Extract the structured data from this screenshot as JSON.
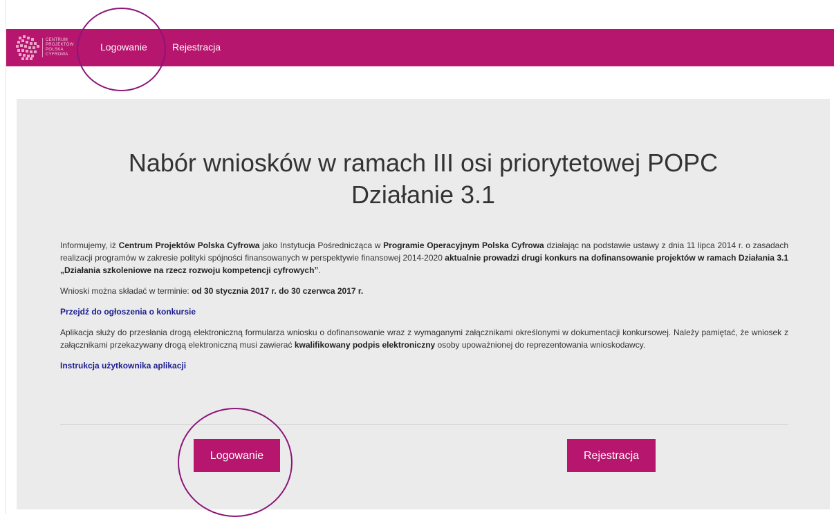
{
  "colors": {
    "brand": "#b6166d",
    "link": "#1b1d8f",
    "panel": "#ebebeb",
    "annotation": "#8b1578"
  },
  "header": {
    "logo_lines": [
      "CENTRUM",
      "PROJEKTÓW",
      "POLSKA",
      "CYFROWA"
    ],
    "logo_icon": "cppc-logo-icon",
    "nav": {
      "login": "Logowanie",
      "register": "Rejestracja"
    }
  },
  "main": {
    "title_line1": "Nabór wniosków w ramach III osi priorytetowej POPC",
    "title_line2": "Działanie 3.1",
    "p1": {
      "t1": "Informujemy, iż ",
      "b1": "Centrum Projektów Polska Cyfrowa",
      "t2": " jako Instytucja Pośrednicząca w ",
      "b2": "Programie Operacyjnym Polska Cyfrowa",
      "t3": " działając na podstawie ustawy z dnia 11 lipca 2014 r. o zasadach realizacji programów w zakresie polityki spójności finansowanych w perspektywie finansowej 2014-2020 ",
      "b3": "aktualnie prowadzi drugi konkurs na dofinansowanie projektów w ramach Działania 3.1 „Działania szkoleniowe na rzecz rozwoju kompetencji cyfrowych”",
      "t4": "."
    },
    "p2": {
      "t1": "Wnioski można składać w terminie: ",
      "b1": "od 30 stycznia 2017 r. do 30 czerwca 2017 r."
    },
    "link_announcement": "Przejdź do ogłoszenia o konkursie",
    "p3": {
      "t1": "Aplikacja służy do przesłania drogą elektroniczną formularza wniosku o dofinansowanie wraz z wymaganymi załącznikami określonymi w dokumentacji konkursowej. Należy pamiętać, że wniosek z załącznikami przekazywany drogą elektroniczną musi zawierać ",
      "b1": "kwalifikowany podpis elektroniczny",
      "t2": " osoby upoważnionej do reprezentowania wnioskodawcy."
    },
    "link_manual": "Instrukcja użytkownika aplikacji",
    "buttons": {
      "login": "Logowanie",
      "register": "Rejestracja"
    }
  }
}
